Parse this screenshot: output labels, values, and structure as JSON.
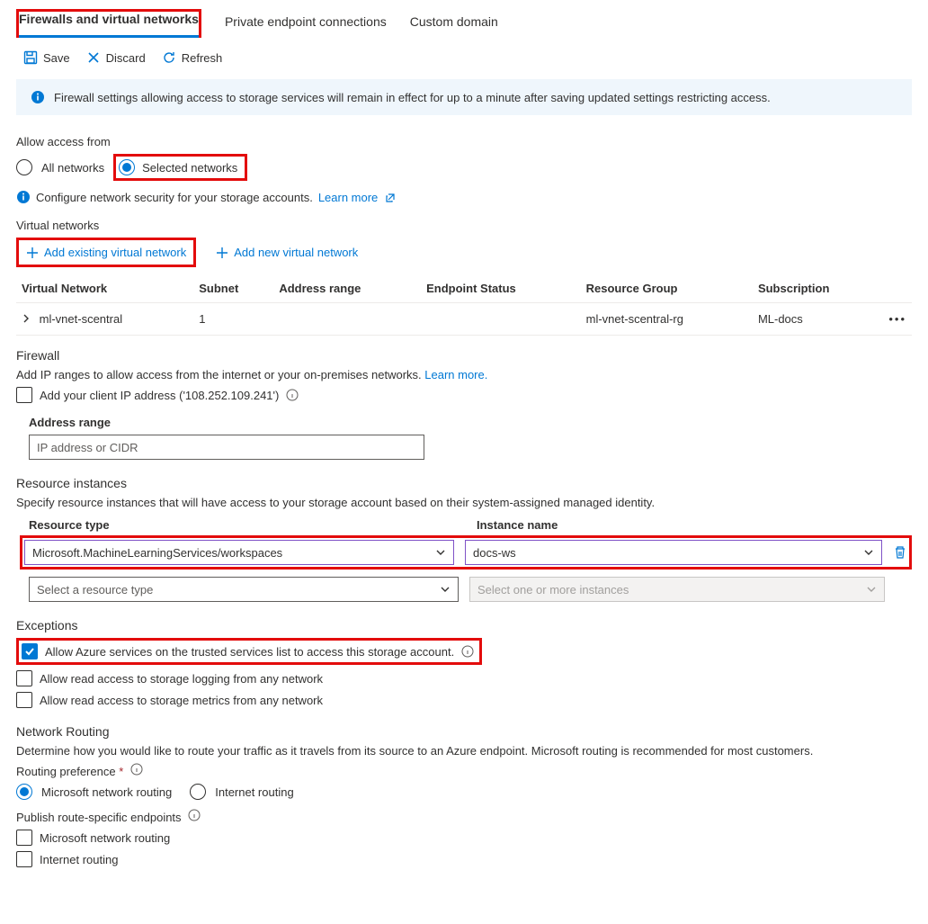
{
  "tabs": {
    "firewalls": "Firewalls and virtual networks",
    "private_ep": "Private endpoint connections",
    "custom_domain": "Custom domain"
  },
  "toolbar": {
    "save": "Save",
    "discard": "Discard",
    "refresh": "Refresh"
  },
  "info_banner": "Firewall settings allowing access to storage services will remain in effect for up to a minute after saving updated settings restricting access.",
  "access": {
    "label": "Allow access from",
    "all": "All networks",
    "selected": "Selected networks",
    "config_text": "Configure network security for your storage accounts.",
    "learn_more": "Learn more"
  },
  "vnet": {
    "heading": "Virtual networks",
    "add_existing": "Add existing virtual network",
    "add_new": "Add new virtual network",
    "cols": {
      "vnet": "Virtual Network",
      "subnet": "Subnet",
      "range": "Address range",
      "endpoint": "Endpoint Status",
      "rg": "Resource Group",
      "sub": "Subscription"
    },
    "rows": [
      {
        "name": "ml-vnet-scentral",
        "subnet": "1",
        "range": "",
        "endpoint": "",
        "rg": "ml-vnet-scentral-rg",
        "sub": "ML-docs"
      }
    ]
  },
  "firewall": {
    "heading": "Firewall",
    "desc_pre": "Add IP ranges to allow access from the internet or your on-premises networks. ",
    "learn_more": "Learn more.",
    "add_client_ip": "Add your client IP address ('108.252.109.241')",
    "address_range_label": "Address range",
    "address_range_placeholder": "IP address or CIDR"
  },
  "ri": {
    "heading": "Resource instances",
    "desc": "Specify resource instances that will have access to your storage account based on their system-assigned managed identity.",
    "col_type": "Resource type",
    "col_name": "Instance name",
    "row1_type": "Microsoft.MachineLearningServices/workspaces",
    "row1_name": "docs-ws",
    "row2_type_placeholder": "Select a resource type",
    "row2_name_placeholder": "Select one or more instances"
  },
  "exceptions": {
    "heading": "Exceptions",
    "trusted": "Allow Azure services on the trusted services list to access this storage account.",
    "logging": "Allow read access to storage logging from any network",
    "metrics": "Allow read access to storage metrics from any network"
  },
  "routing": {
    "heading": "Network Routing",
    "desc": "Determine how you would like to route your traffic as it travels from its source to an Azure endpoint. Microsoft routing is recommended for most customers.",
    "pref_label": "Routing preference",
    "ms_routing": "Microsoft network routing",
    "internet_routing": "Internet routing",
    "publish_label": "Publish route-specific endpoints",
    "pub_ms": "Microsoft network routing",
    "pub_internet": "Internet routing"
  }
}
